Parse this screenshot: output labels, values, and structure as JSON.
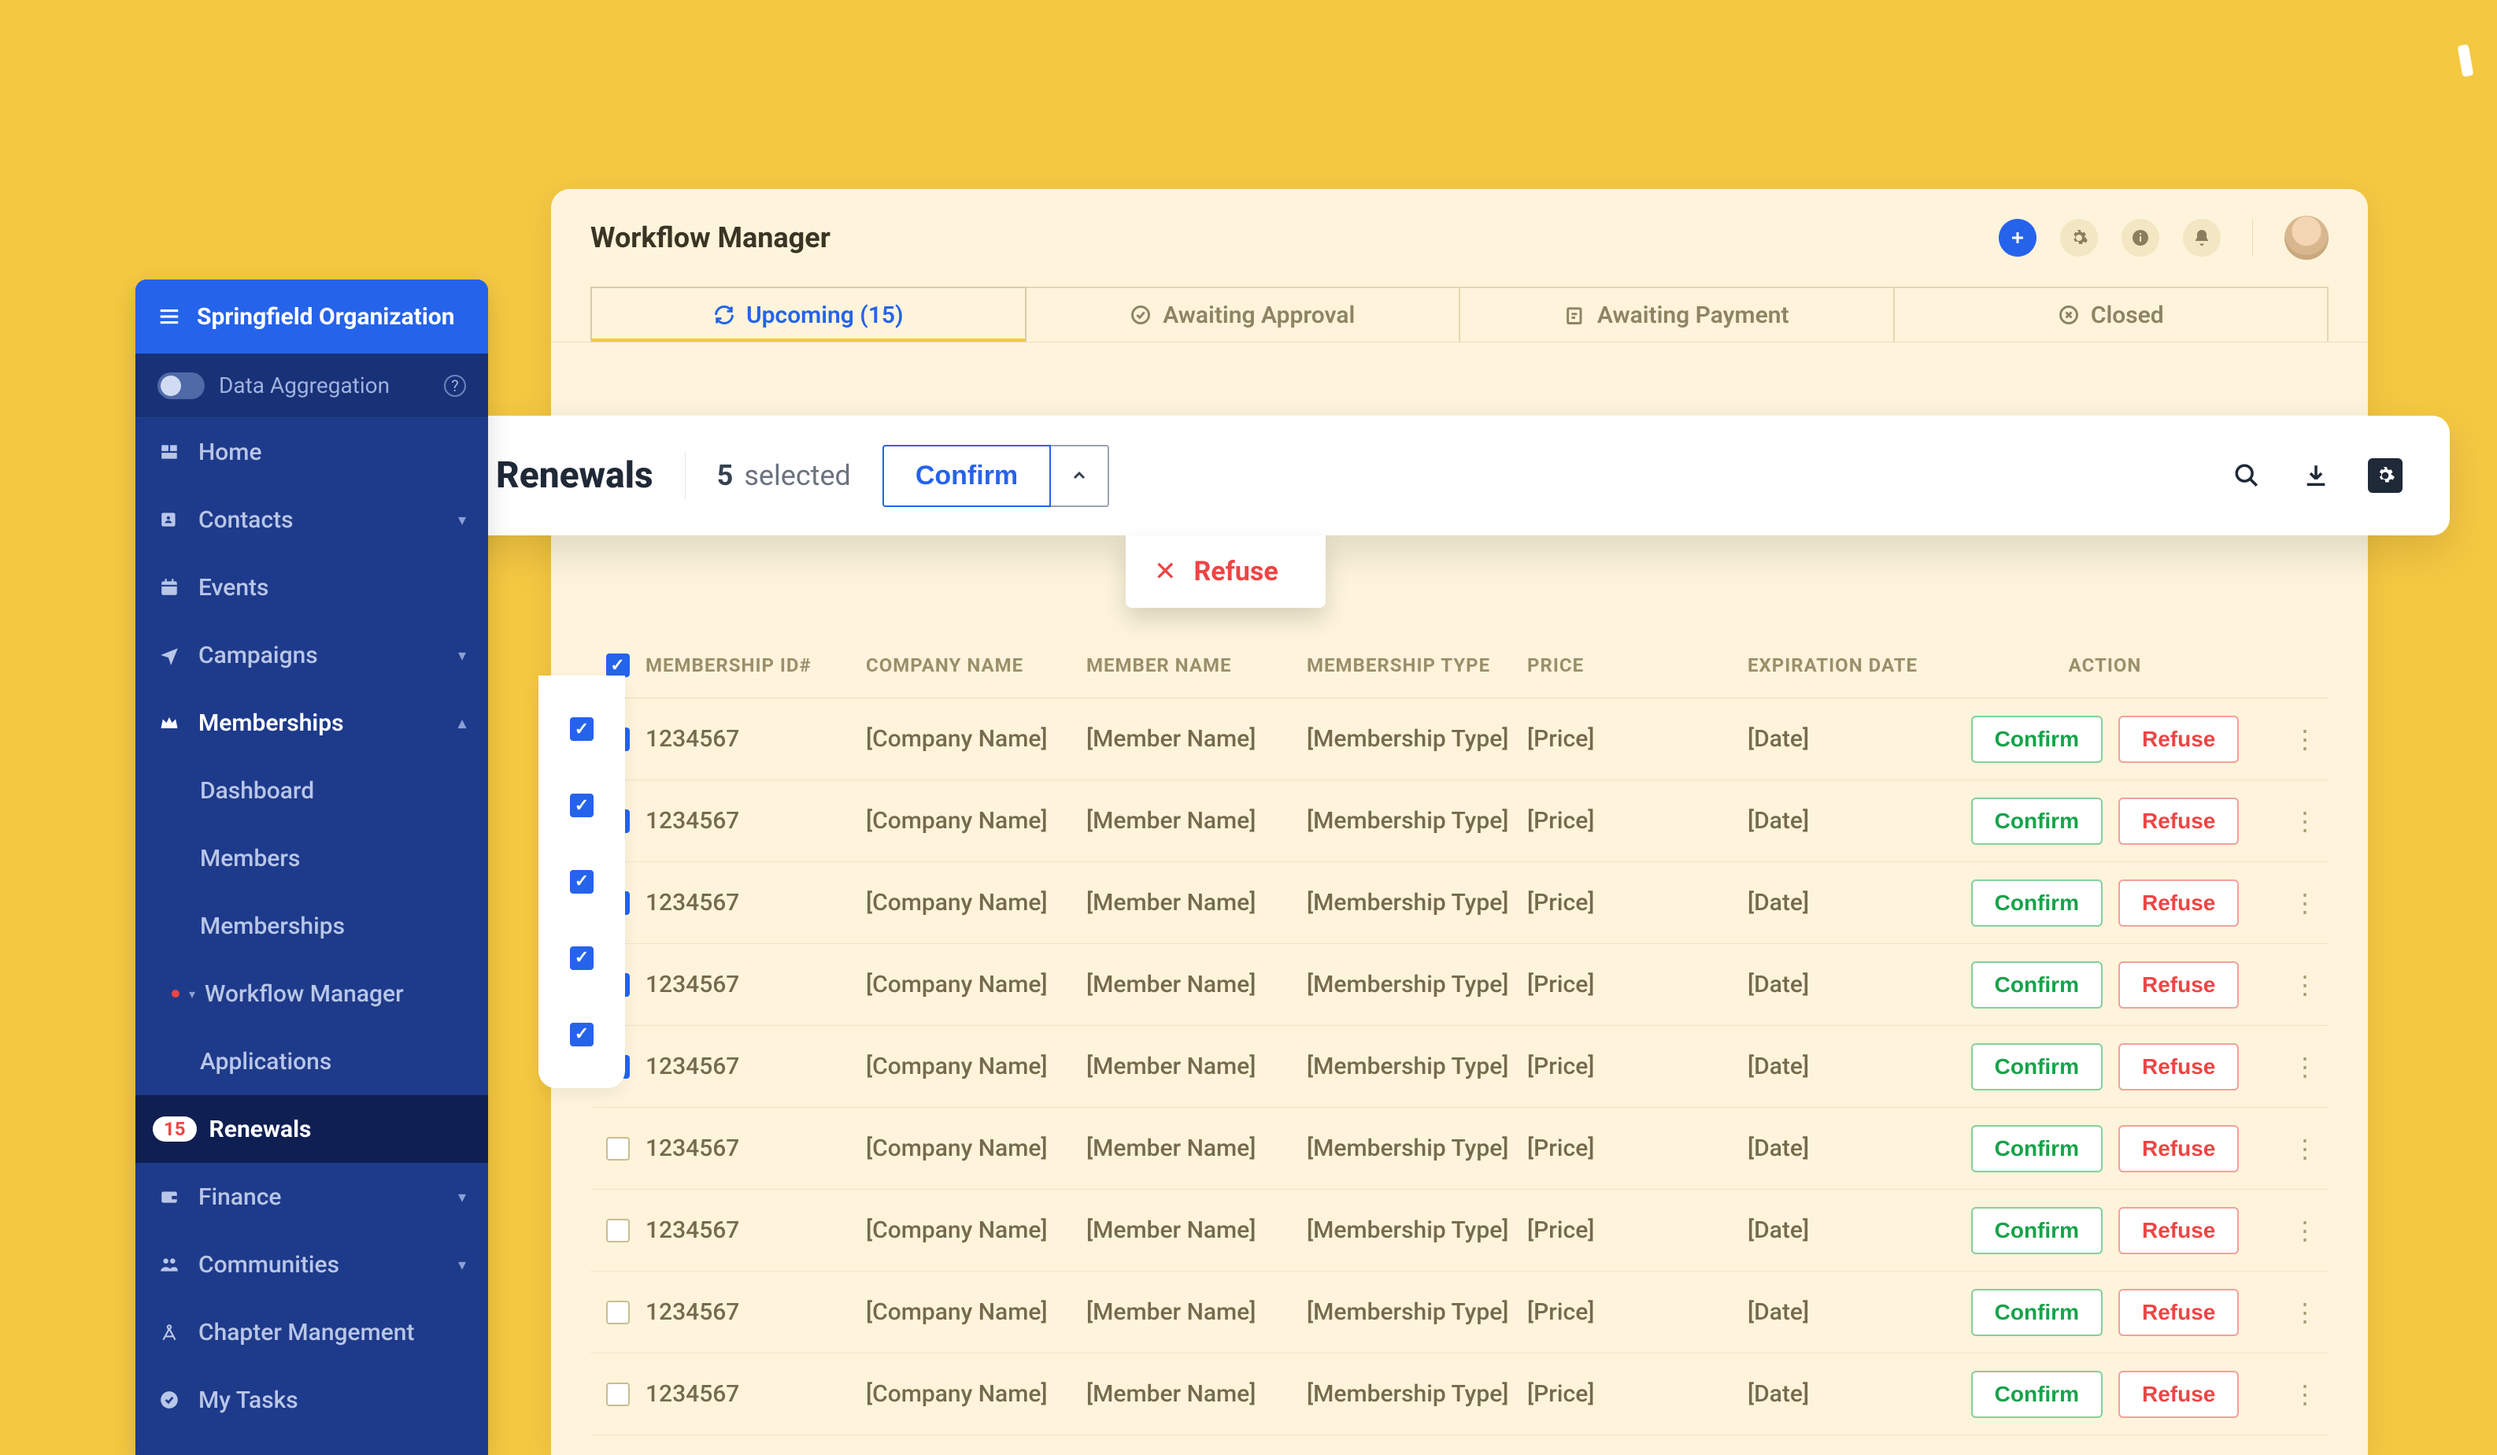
{
  "decor": {},
  "app": {
    "title": "Workflow Manager"
  },
  "tabs": {
    "upcoming": "Upcoming (15)",
    "awaiting_approval": "Awaiting Approval",
    "awaiting_payment": "Awaiting Payment",
    "closed": "Closed"
  },
  "floatbar": {
    "title": "Renewals",
    "count": "5",
    "selected": "selected",
    "confirm": "Confirm",
    "refuse": "Refuse"
  },
  "table": {
    "headers": {
      "id": "MEMBERSHIP ID#",
      "company": "COMPANY NAME",
      "member": "MEMBER NAME",
      "type": "MEMBERSHIP TYPE",
      "price": "PRICE",
      "exp": "EXPIRATION DATE",
      "action": "ACTION"
    },
    "rows": [
      {
        "checked": true,
        "id": "1234567",
        "company": "[Company Name]",
        "member": "[Member Name]",
        "type": "[Membership Type]",
        "price": "[Price]",
        "exp": "[Date]"
      },
      {
        "checked": true,
        "id": "1234567",
        "company": "[Company Name]",
        "member": "[Member Name]",
        "type": "[Membership Type]",
        "price": "[Price]",
        "exp": "[Date]"
      },
      {
        "checked": true,
        "id": "1234567",
        "company": "[Company Name]",
        "member": "[Member Name]",
        "type": "[Membership Type]",
        "price": "[Price]",
        "exp": "[Date]"
      },
      {
        "checked": true,
        "id": "1234567",
        "company": "[Company Name]",
        "member": "[Member Name]",
        "type": "[Membership Type]",
        "price": "[Price]",
        "exp": "[Date]"
      },
      {
        "checked": true,
        "id": "1234567",
        "company": "[Company Name]",
        "member": "[Member Name]",
        "type": "[Membership Type]",
        "price": "[Price]",
        "exp": "[Date]"
      },
      {
        "checked": false,
        "id": "1234567",
        "company": "[Company Name]",
        "member": "[Member Name]",
        "type": "[Membership Type]",
        "price": "[Price]",
        "exp": "[Date]"
      },
      {
        "checked": false,
        "id": "1234567",
        "company": "[Company Name]",
        "member": "[Member Name]",
        "type": "[Membership Type]",
        "price": "[Price]",
        "exp": "[Date]"
      },
      {
        "checked": false,
        "id": "1234567",
        "company": "[Company Name]",
        "member": "[Member Name]",
        "type": "[Membership Type]",
        "price": "[Price]",
        "exp": "[Date]"
      },
      {
        "checked": false,
        "id": "1234567",
        "company": "[Company Name]",
        "member": "[Member Name]",
        "type": "[Membership Type]",
        "price": "[Price]",
        "exp": "[Date]"
      }
    ],
    "confirm_label": "Confirm",
    "refuse_label": "Refuse"
  },
  "sidebar": {
    "org": "Springfield Organization",
    "data_aggregation": "Data Aggregation",
    "items": {
      "home": "Home",
      "contacts": "Contacts",
      "events": "Events",
      "campaigns": "Campaigns",
      "memberships": "Memberships",
      "dashboard": "Dashboard",
      "members": "Members",
      "memberships_sub": "Memberships",
      "workflow_manager": "Workflow Manager",
      "applications": "Applications",
      "renewals": "Renewals",
      "renewals_badge": "15",
      "finance": "Finance",
      "communities": "Communities",
      "chapter": "Chapter Mangement",
      "mytasks": "My Tasks"
    }
  }
}
